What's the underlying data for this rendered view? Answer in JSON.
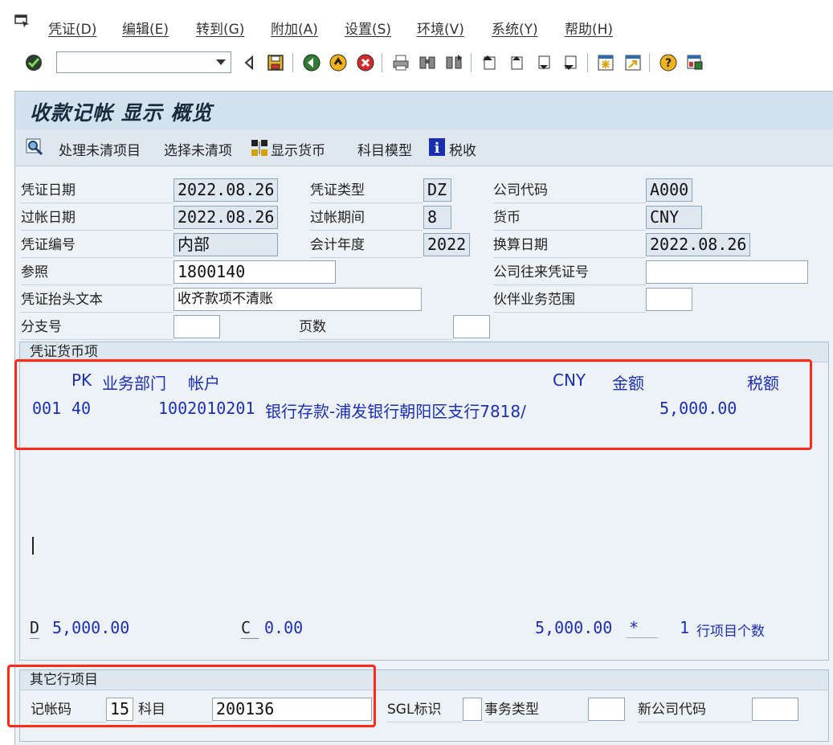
{
  "menu": {
    "items": [
      "凭证(D)",
      "编辑(E)",
      "转到(G)",
      "附加(A)",
      "设置(S)",
      "环境(V)",
      "系统(Y)",
      "帮助(H)"
    ]
  },
  "toolbar": {
    "command_field_value": ""
  },
  "screen": {
    "title": "收款记帐 显示 概览"
  },
  "appbar": {
    "process_open_items": "处理未清项目",
    "select_open_items": "选择未清项",
    "show_currency": "显示货币",
    "account_model": "科目模型",
    "tax": "税收"
  },
  "header": {
    "doc_date_label": "凭证日期",
    "doc_date": "2022.08.26",
    "doc_type_label": "凭证类型",
    "doc_type": "DZ",
    "company_code_label": "公司代码",
    "company_code": "A000",
    "posting_date_label": "过帐日期",
    "posting_date": "2022.08.26",
    "period_label": "过帐期间",
    "period": "8",
    "currency_label": "货币",
    "currency": "CNY",
    "doc_number_label": "凭证编号",
    "doc_number": "内部",
    "fiscal_year_label": "会计年度",
    "fiscal_year": "2022",
    "translation_date_label": "换算日期",
    "translation_date": "2022.08.26",
    "reference_label": "参照",
    "reference": "1800140",
    "intercompany_label": "公司往来凭证号",
    "intercompany": "",
    "header_text_label": "凭证抬头文本",
    "header_text": "收齐款项不清账",
    "partner_area_label": "伙伴业务范围",
    "partner_area": "",
    "branch_label": "分支号",
    "branch": "",
    "pages_label": "页数",
    "pages": ""
  },
  "items": {
    "group_title": "凭证货币项",
    "columns": {
      "pk": "PK",
      "bus_area": "业务部门",
      "account": "帐户",
      "currency": "CNY",
      "amount": "金额",
      "tax": "税额"
    },
    "rows": [
      {
        "no": "001",
        "pk": "40",
        "account": "1002010201",
        "desc": "银行存款-浦发银行朝阳区支行7818/",
        "amount": "5,000.00"
      }
    ],
    "debit_label": "D",
    "debit_total": "5,000.00",
    "credit_label": "C",
    "credit_total": "0.00",
    "balance": "5,000.00",
    "balance_marker": "*",
    "line_count": "1",
    "line_count_label": "行项目个数"
  },
  "other_line": {
    "group_title": "其它行项目",
    "posting_key_label": "记帐码",
    "posting_key": "15",
    "account_label": "科目",
    "account": "200136",
    "sgl_label": "SGL标识",
    "sgl": "",
    "trans_type_label": "事务类型",
    "trans_type": "",
    "new_company_label": "新公司代码",
    "new_company": ""
  },
  "colors": {
    "highlight": "#ff2a1a",
    "item_text": "#1c2fb4"
  }
}
